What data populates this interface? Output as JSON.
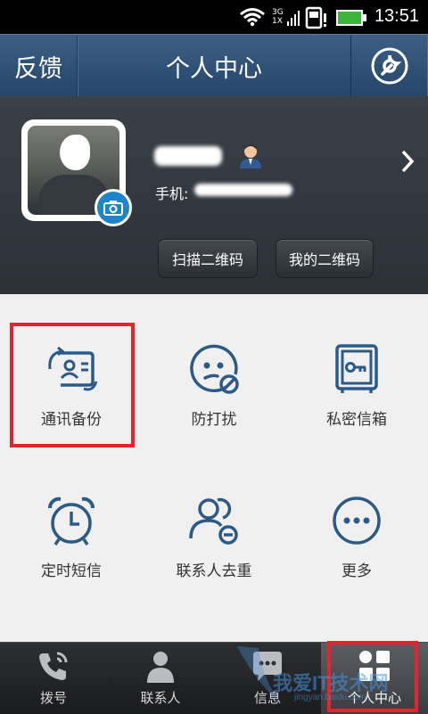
{
  "status_bar": {
    "time": "13:51",
    "network": "3G",
    "network2": "1X"
  },
  "header": {
    "left_label": "反馈",
    "title": "个人中心",
    "right_icon": "wrench-icon"
  },
  "profile": {
    "phone_label": "手机:",
    "scan_qr_label": "扫描二维码",
    "my_qr_label": "我的二维码"
  },
  "features": [
    {
      "label": "通讯备份",
      "icon": "contacts-backup-icon"
    },
    {
      "label": "防打扰",
      "icon": "do-not-disturb-icon"
    },
    {
      "label": "私密信箱",
      "icon": "private-safe-icon"
    },
    {
      "label": "定时短信",
      "icon": "alarm-clock-icon"
    },
    {
      "label": "联系人去重",
      "icon": "contacts-dedupe-icon"
    },
    {
      "label": "更多",
      "icon": "more-icon"
    }
  ],
  "bottom_nav": [
    {
      "label": "拨号",
      "icon": "phone-icon"
    },
    {
      "label": "联系人",
      "icon": "contact-icon"
    },
    {
      "label": "信息",
      "icon": "message-icon"
    },
    {
      "label": "个人中心",
      "icon": "grid-icon",
      "active": true
    }
  ],
  "watermark": {
    "text": "我爱IT技术网",
    "subtext": "jingyan.baidu.com"
  },
  "colors": {
    "header": "#2e5078",
    "icon_blue": "#2b5a86",
    "highlight": "#e8232b",
    "camera_badge": "#1f84c8"
  }
}
